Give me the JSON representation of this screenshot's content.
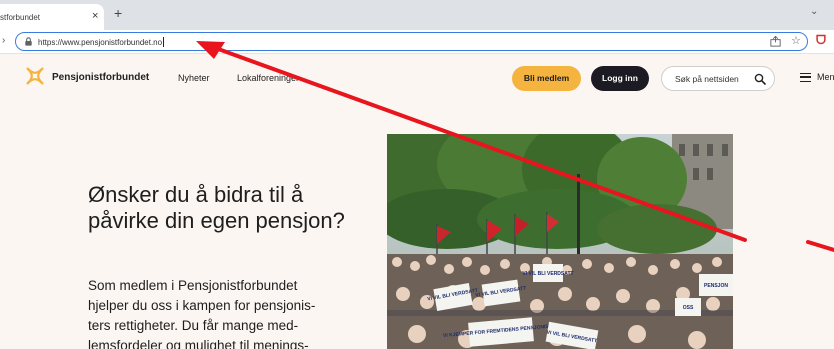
{
  "browser": {
    "tab_title": "stforbundet",
    "tab_close": "×",
    "new_tab": "+",
    "tab_menu": "⌄",
    "url": "https://www.pensjonistforbundet.no",
    "reload_icon": "↻",
    "star_icon": "☆"
  },
  "site": {
    "brand": "Pensjonistforbundet",
    "nav": [
      "Nyheter",
      "Lokalforeninger"
    ],
    "member_button": "Bli medlem",
    "login_button": "Logg inn",
    "search_label": "Søk på nettsiden",
    "menu_label": "Meny"
  },
  "hero": {
    "title": "Ønsker du å bidra til å påvirke din egen pensjon?",
    "body": "Som medlem i Pensjonistforbundet\nhjelper du oss i kampen for pensjonis-\nters rettigheter. Du får mange med-\nlemsfordeler og mulighet til menings-",
    "photo_signs": [
      "VI VIL BLI VERDSATT",
      "VI VIL BLI VERDSATT",
      "VI VIL BLI VERDSATT",
      "VI KJEMPER FOR FREMTIDENS PENSJONISTER",
      "OSS",
      "PENSJON",
      "VI VIL BLI VERDSATT"
    ]
  },
  "colors": {
    "accent": "#f4b43f",
    "login_bg": "#1c1b23",
    "page_bg": "#fbf6f1",
    "arrow": "#e8141e",
    "omnibox_focus": "#3a7be0"
  }
}
